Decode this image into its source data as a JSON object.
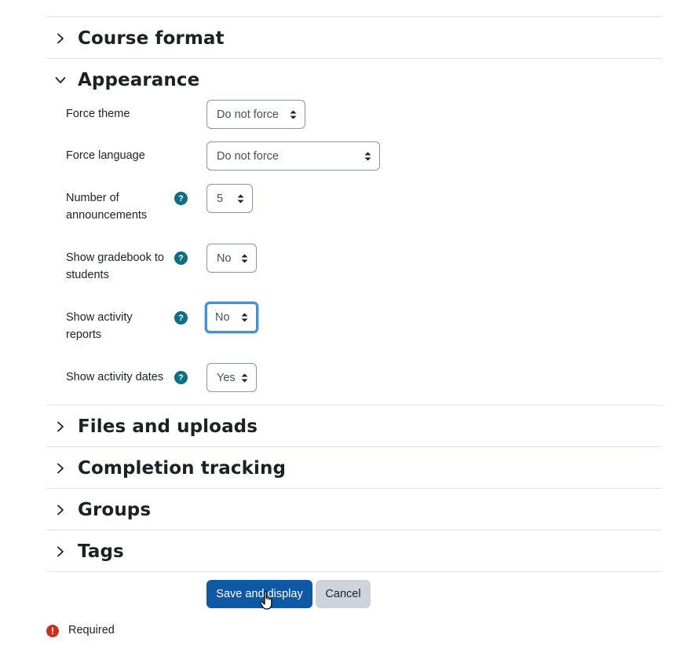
{
  "sections": {
    "course_format": "Course format",
    "appearance": "Appearance",
    "files_uploads": "Files and uploads",
    "completion": "Completion tracking",
    "groups": "Groups",
    "tags": "Tags"
  },
  "appearance": {
    "force_theme": {
      "label": "Force theme",
      "value": "Do not force"
    },
    "force_language": {
      "label": "Force language",
      "value": "Do not force"
    },
    "announcements": {
      "label_line1": "Number of",
      "label_line2": "announcements",
      "value": "5"
    },
    "gradebook": {
      "label_line1": "Show gradebook to",
      "label_line2": "students",
      "value": "No"
    },
    "activity_reports": {
      "label_line1": "Show activity",
      "label_line2": "reports",
      "value": "No"
    },
    "activity_dates": {
      "label": "Show activity dates",
      "value": "Yes"
    }
  },
  "help_icon_glyph": "?",
  "buttons": {
    "save": "Save and display",
    "cancel": "Cancel"
  },
  "required": {
    "icon_glyph": "!",
    "label": "Required"
  },
  "colors": {
    "primary": "#0f58a3",
    "help": "#0f6e82",
    "required": "#ca3120",
    "focus": "#4a90d0"
  }
}
